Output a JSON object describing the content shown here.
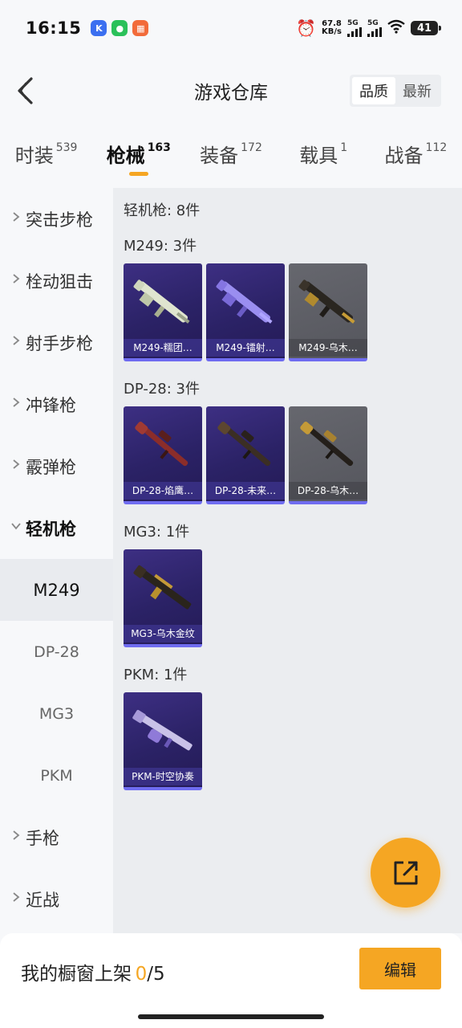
{
  "status": {
    "time": "16:15",
    "net_speed_value": "67.8",
    "net_speed_unit": "KB/s",
    "sim1": "5G",
    "sim2": "5G",
    "battery": "41"
  },
  "header": {
    "title": "游戏仓库",
    "sort_options": [
      "品质",
      "最新"
    ]
  },
  "tabs": [
    {
      "label": "时装",
      "count": "539"
    },
    {
      "label": "枪械",
      "count": "163"
    },
    {
      "label": "装备",
      "count": "172"
    },
    {
      "label": "载具",
      "count": "1"
    },
    {
      "label": "战备",
      "count": "112"
    }
  ],
  "sidebar": {
    "categories": [
      "突击步枪",
      "栓动狙击",
      "射手步枪",
      "冲锋枪",
      "霰弹枪",
      "轻机枪",
      "手枪",
      "近战"
    ],
    "open_category": "轻机枪",
    "subitems": [
      "M249",
      "DP-28",
      "MG3",
      "PKM"
    ],
    "active_subitem": "M249"
  },
  "main": {
    "category_title": "轻机枪: 8件",
    "groups": [
      {
        "title": "M249: 3件",
        "items": [
          {
            "name": "M249-糯团…",
            "rarity": "purple"
          },
          {
            "name": "M249-镭射…",
            "rarity": "purple"
          },
          {
            "name": "M249-乌木…",
            "rarity": "gray"
          }
        ]
      },
      {
        "title": "DP-28: 3件",
        "items": [
          {
            "name": "DP-28-焰鹰…",
            "rarity": "purple"
          },
          {
            "name": "DP-28-未来…",
            "rarity": "purple"
          },
          {
            "name": "DP-28-乌木…",
            "rarity": "gray"
          }
        ]
      },
      {
        "title": "MG3: 1件",
        "items": [
          {
            "name": "MG3-乌木金纹",
            "rarity": "purple"
          }
        ]
      },
      {
        "title": "PKM: 1件",
        "items": [
          {
            "name": "PKM-时空协奏",
            "rarity": "purple"
          }
        ]
      }
    ]
  },
  "bottom": {
    "showcase_label": "我的橱窗上架",
    "showcase_current": "0",
    "showcase_total": "/5",
    "edit_label": "编辑"
  },
  "colors": {
    "accent": "#f5a623",
    "card_purple": "#2b2266",
    "card_gray": "#5b5c63",
    "rarity_bar": "#6f6cf0"
  }
}
